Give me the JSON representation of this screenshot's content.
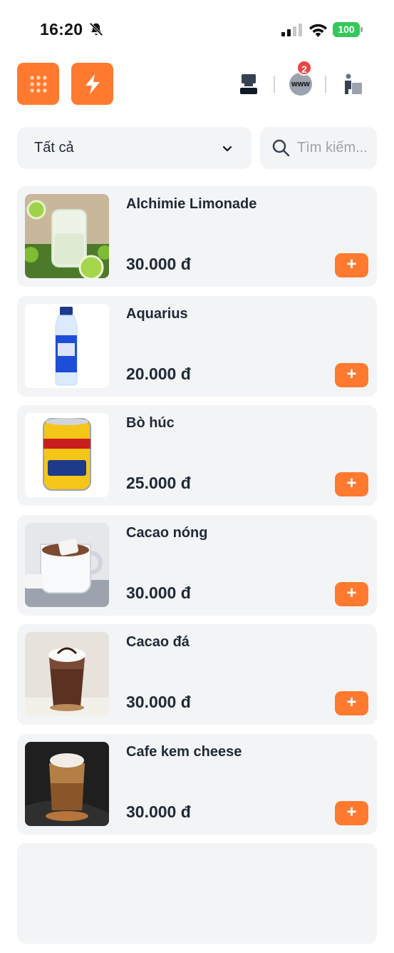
{
  "status_bar": {
    "time": "16:20",
    "battery": "100"
  },
  "toolbar": {
    "grid_icon": "grid-icon",
    "bolt_icon": "bolt-icon",
    "www_label": "www",
    "notification_count": "2"
  },
  "filter": {
    "category_selected": "Tất cả",
    "search_placeholder": "Tìm kiếm..."
  },
  "colors": {
    "accent": "#ff7a2f",
    "card_bg": "#f3f4f6",
    "badge": "#ef4444",
    "battery": "#34c759"
  },
  "products": [
    {
      "name": "Alchimie Limonade",
      "price": "30.000 đ",
      "image": "limonade-image"
    },
    {
      "name": "Aquarius",
      "price": "20.000 đ",
      "image": "aquarius-bottle-image"
    },
    {
      "name": "Bò húc",
      "price": "25.000 đ",
      "image": "redbull-can-image"
    },
    {
      "name": "Cacao nóng",
      "price": "30.000 đ",
      "image": "hot-cocoa-image"
    },
    {
      "name": "Cacao đá",
      "price": "30.000 đ",
      "image": "iced-cocoa-image"
    },
    {
      "name": "Cafe kem cheese",
      "price": "30.000 đ",
      "image": "cheese-coffee-image"
    }
  ],
  "add_label": "+"
}
